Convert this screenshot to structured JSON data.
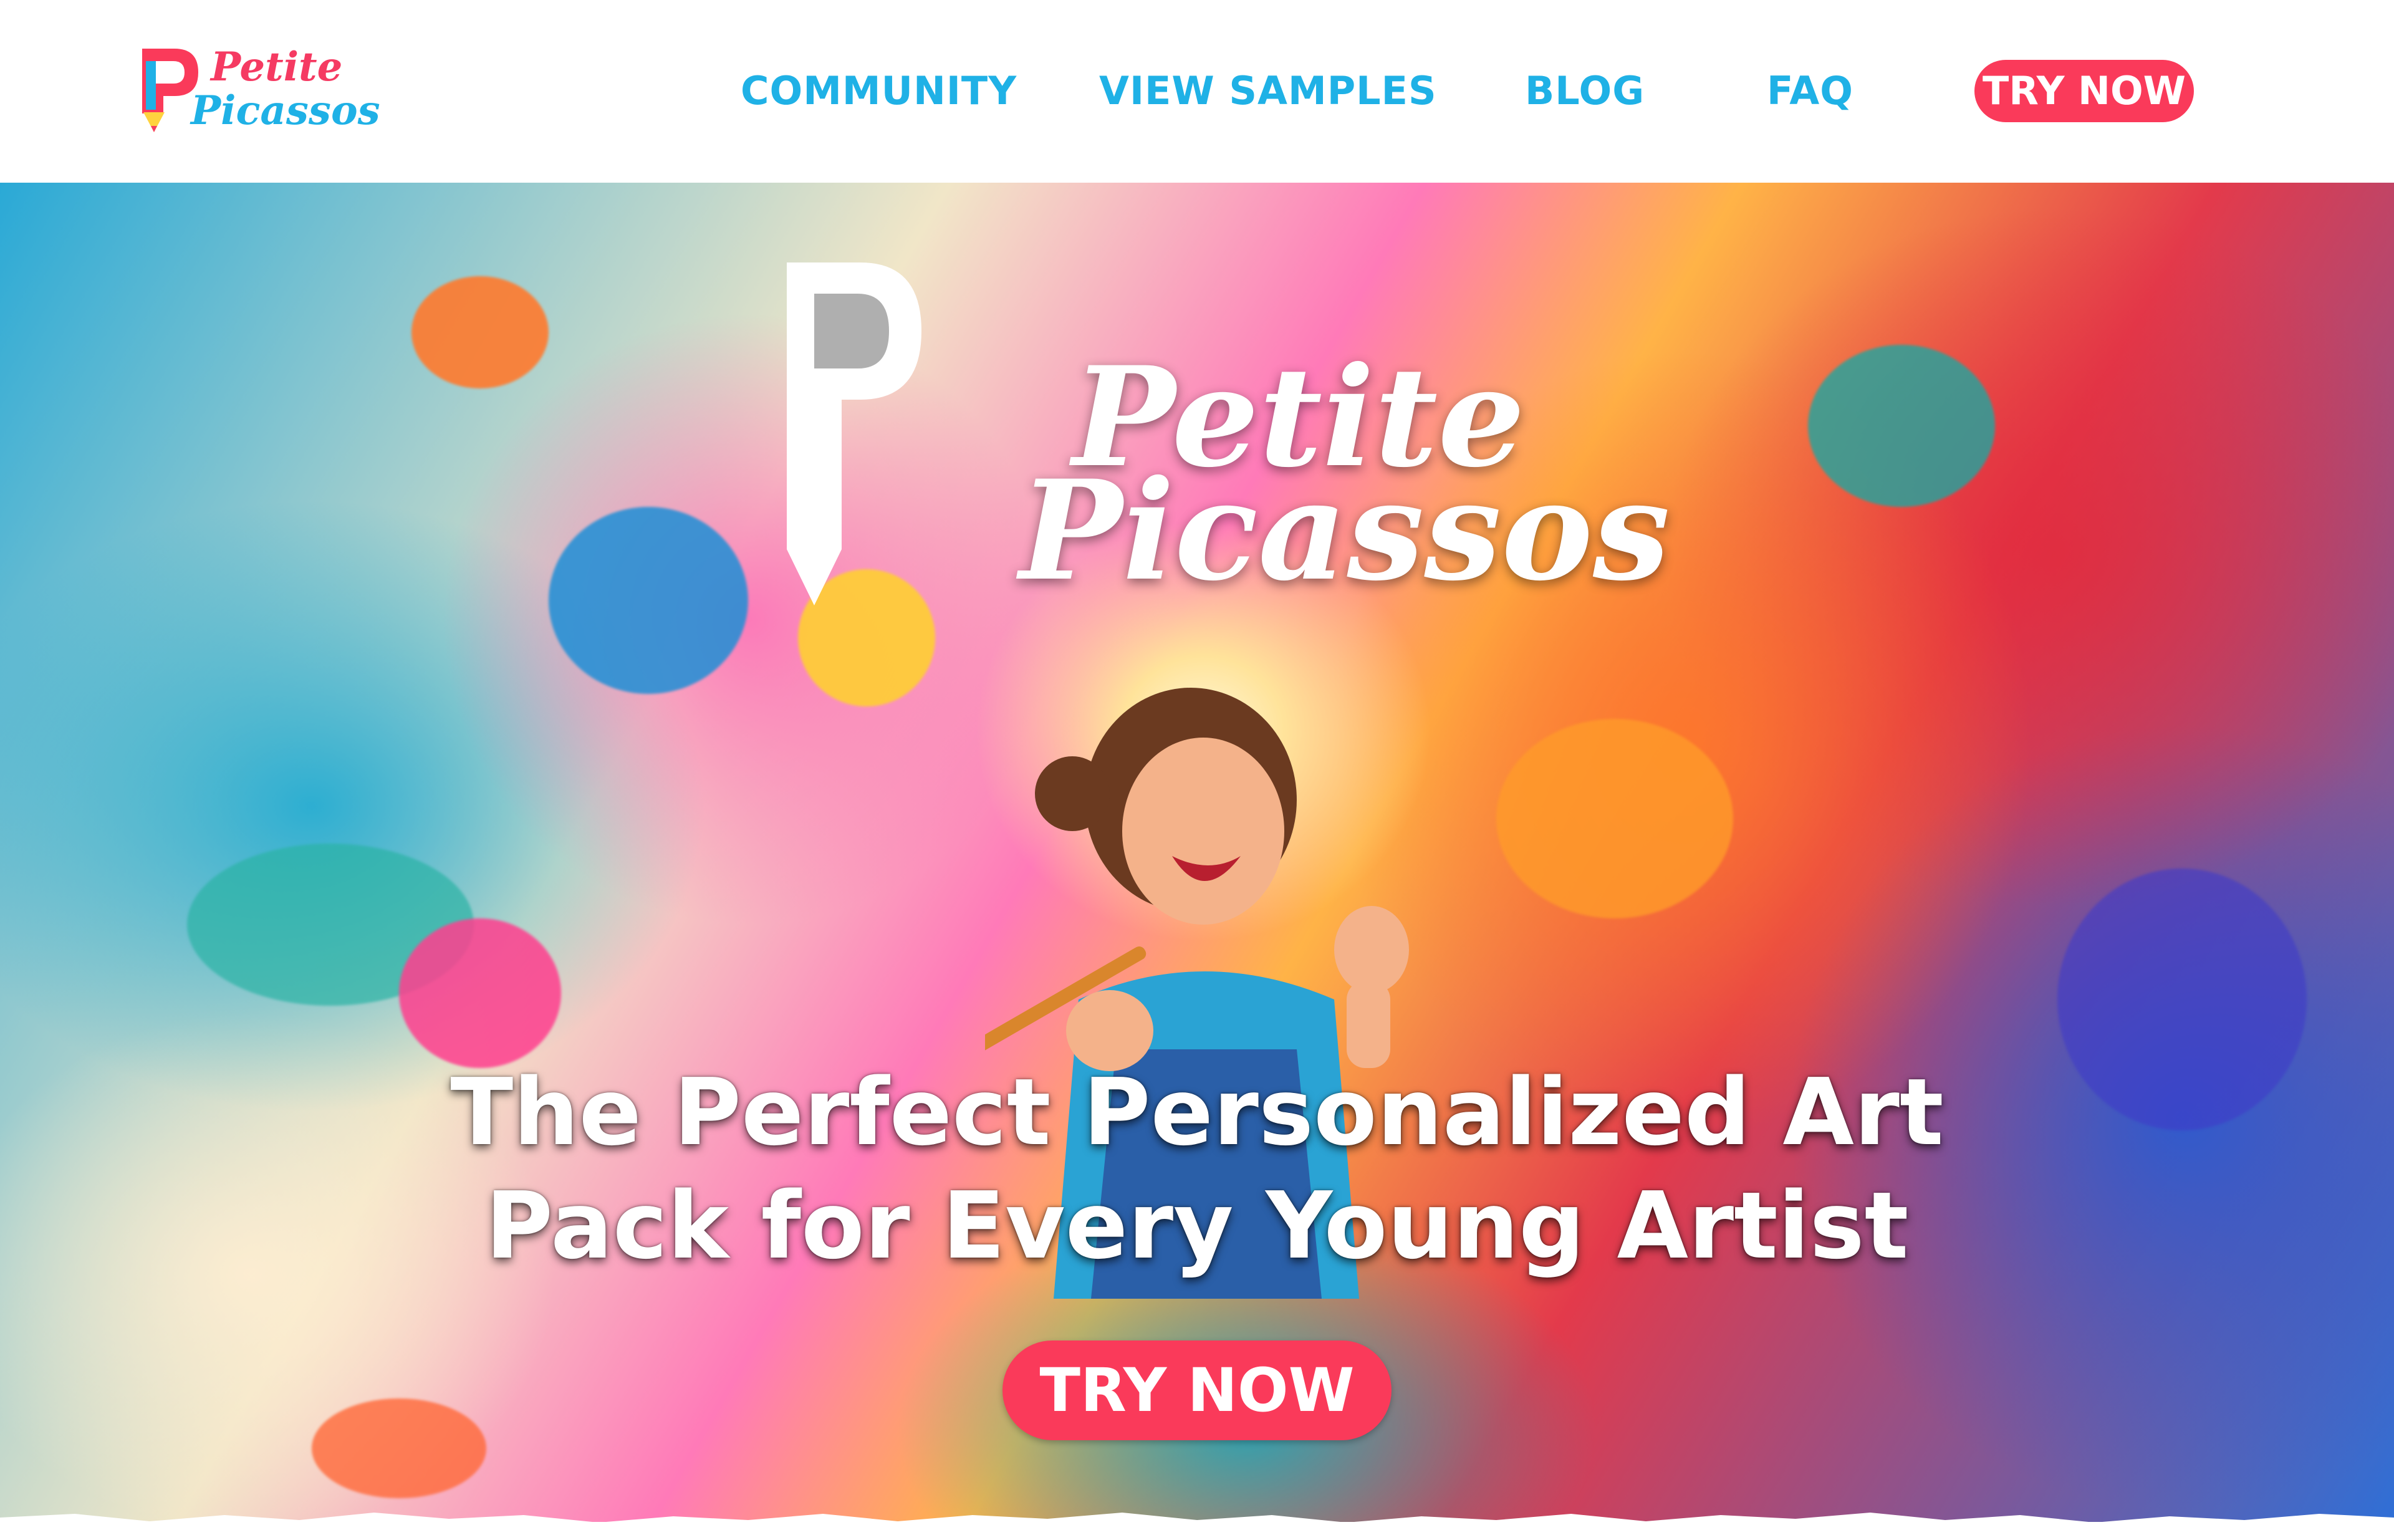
{
  "brand": {
    "name_line1": "Petite",
    "name_line2": "Picassos",
    "colors": {
      "pink": "#fa3a5a",
      "blue": "#1fb1e6",
      "yellow": "#ffd23f"
    }
  },
  "nav": {
    "items": [
      {
        "label": "COMMUNITY"
      },
      {
        "label": "VIEW SAMPLES"
      },
      {
        "label": "BLOG"
      },
      {
        "label": "FAQ"
      }
    ],
    "cta_label": "TRY NOW"
  },
  "hero": {
    "logo_line1": "Petite",
    "logo_line2": "Picassos",
    "headline_line1": "The Perfect Personalized Art",
    "headline_line2": "Pack for Every Young Artist",
    "cta_label": "TRY NOW",
    "image_description_icon": "child-painting-illustration"
  }
}
